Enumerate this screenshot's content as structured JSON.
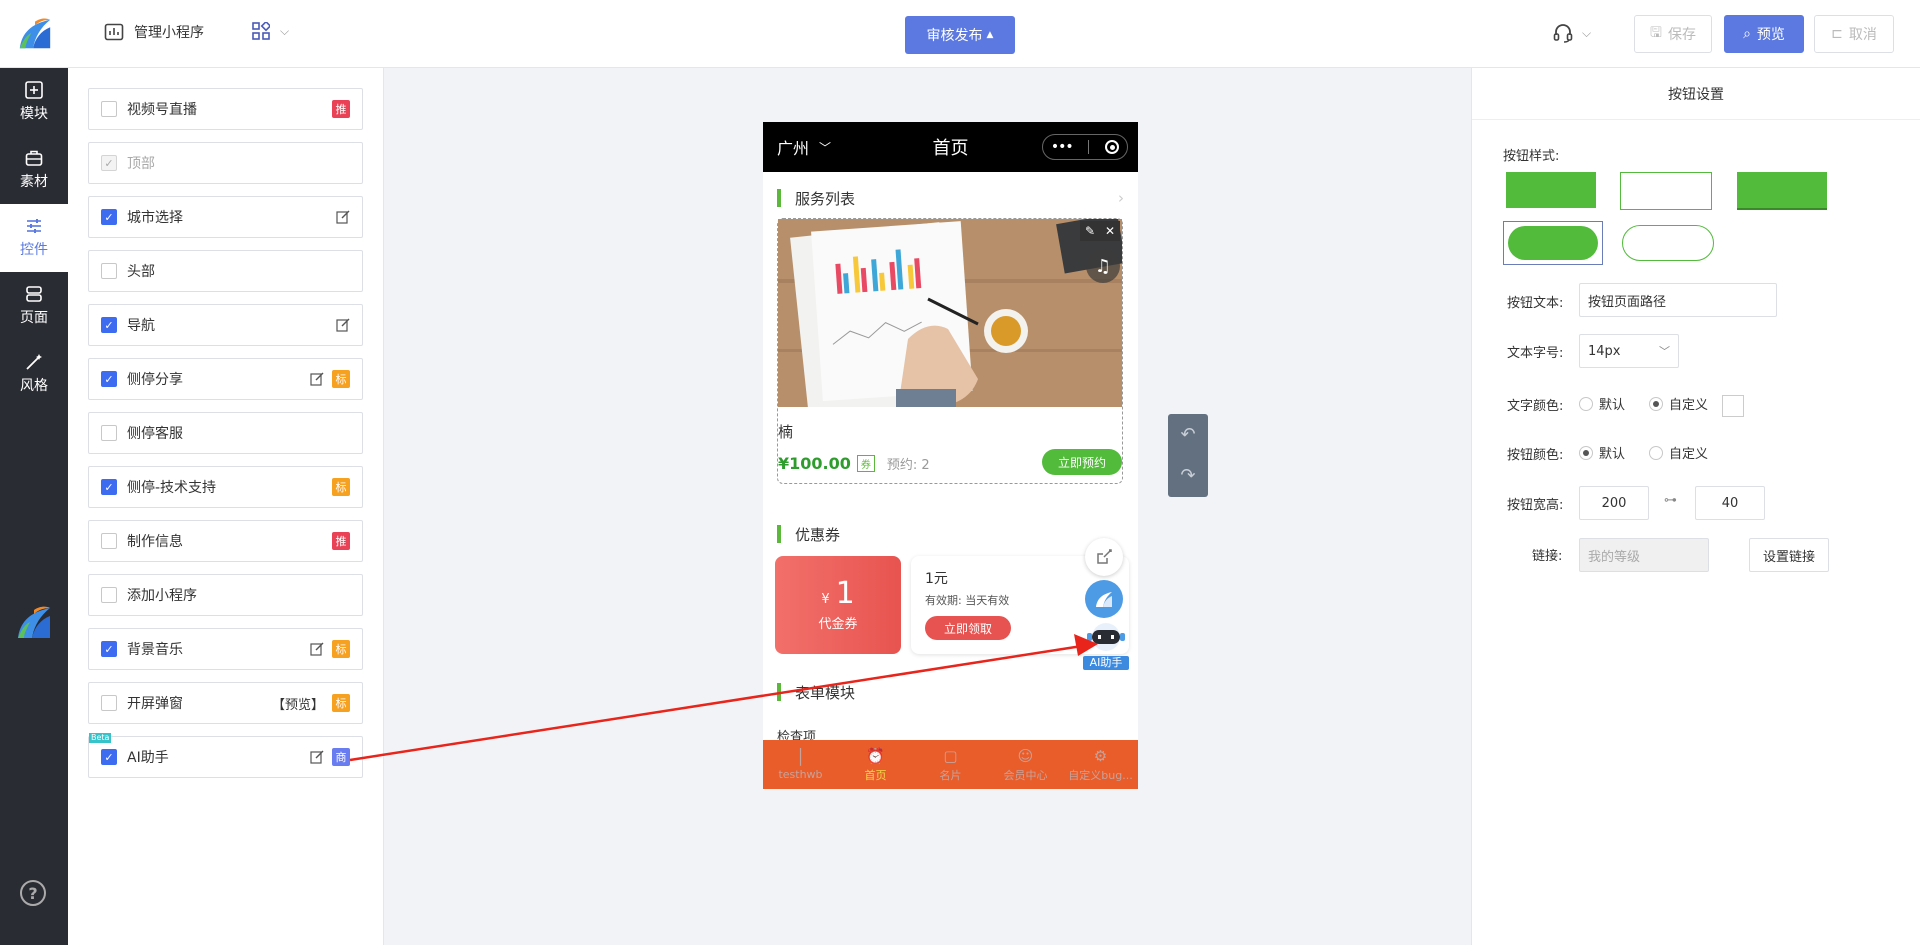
{
  "header": {
    "manage_label": "管理小程序",
    "publish_label": "审核发布",
    "save_label": "保存",
    "preview_label": "预览",
    "cancel_label": "取消"
  },
  "leftnav": {
    "items": [
      {
        "label": "模块",
        "icon": "plus-square-icon"
      },
      {
        "label": "素材",
        "icon": "briefcase-icon"
      },
      {
        "label": "控件",
        "icon": "sliders-icon"
      },
      {
        "label": "页面",
        "icon": "server-icon"
      },
      {
        "label": "风格",
        "icon": "magic-wand-icon"
      }
    ],
    "help": "?"
  },
  "controls": {
    "items": [
      {
        "label": "视频号直播",
        "checked": false,
        "disabled": false,
        "edit": false,
        "tag": "推",
        "tag_color": "red"
      },
      {
        "label": "顶部",
        "checked": true,
        "disabled": true,
        "edit": false,
        "tag": "",
        "tag_color": ""
      },
      {
        "label": "城市选择",
        "checked": true,
        "disabled": false,
        "edit": true,
        "tag": "",
        "tag_color": ""
      },
      {
        "label": "头部",
        "checked": false,
        "disabled": false,
        "edit": false,
        "tag": "",
        "tag_color": ""
      },
      {
        "label": "导航",
        "checked": true,
        "disabled": false,
        "edit": true,
        "tag": "",
        "tag_color": ""
      },
      {
        "label": "侧停分享",
        "checked": true,
        "disabled": false,
        "edit": true,
        "tag": "标",
        "tag_color": "orange"
      },
      {
        "label": "侧停客服",
        "checked": false,
        "disabled": false,
        "edit": false,
        "tag": "",
        "tag_color": ""
      },
      {
        "label": "侧停-技术支持",
        "checked": true,
        "disabled": false,
        "edit": false,
        "tag": "标",
        "tag_color": "orange"
      },
      {
        "label": "制作信息",
        "checked": false,
        "disabled": false,
        "edit": false,
        "tag": "推",
        "tag_color": "red"
      },
      {
        "label": "添加小程序",
        "checked": false,
        "disabled": false,
        "edit": false,
        "tag": "",
        "tag_color": ""
      },
      {
        "label": "背景音乐",
        "checked": true,
        "disabled": false,
        "edit": true,
        "tag": "标",
        "tag_color": "orange"
      },
      {
        "label": "开屏弹窗",
        "checked": false,
        "disabled": false,
        "edit": false,
        "extra": "【预览】",
        "tag": "标",
        "tag_color": "orange"
      },
      {
        "label": "AI助手",
        "checked": true,
        "disabled": false,
        "edit": true,
        "tag": "商",
        "tag_color": "blue",
        "beta": "Beta"
      }
    ]
  },
  "phone": {
    "city": "广州",
    "title": "首页",
    "service_title": "服务列表",
    "card_name": "楠",
    "price": "¥100.00",
    "quan": "券",
    "booked": "预约: 2",
    "book_btn": "立即预约",
    "coupon_title": "优惠券",
    "coupon_currency": "¥",
    "coupon_amount": "1",
    "coupon_type": "代金券",
    "coupon_name": "1元",
    "coupon_valid": "有效期: 当天有效",
    "coupon_btn": "立即领取",
    "ai_label": "AI助手",
    "form_title": "表单模块",
    "form_item": "检查项",
    "tabs": [
      {
        "label": "testhwb",
        "active": false
      },
      {
        "label": "首页",
        "active": true
      },
      {
        "label": "名片",
        "active": false
      },
      {
        "label": "会员中心",
        "active": false
      },
      {
        "label": "自定义bug...",
        "active": false
      }
    ]
  },
  "settings": {
    "title": "按钮设置",
    "style_label": "按钮样式:",
    "text_label": "按钮文本:",
    "text_value": "按钮页面路径",
    "size_label": "文本字号:",
    "size_value": "14px",
    "color_label": "文字颜色:",
    "color_default": "默认",
    "color_custom": "自定义",
    "btn_color_label": "按钮颜色:",
    "btn_color_default": "默认",
    "btn_color_custom": "自定义",
    "wh_label": "按钮宽高:",
    "width_value": "200",
    "height_value": "40",
    "link_label": "链接:",
    "link_placeholder": "我的等级",
    "link_btn": "设置链接"
  },
  "colors": {
    "accent": "#5b79e0",
    "green": "#52bb3b",
    "tabbar": "#e95d2a"
  }
}
